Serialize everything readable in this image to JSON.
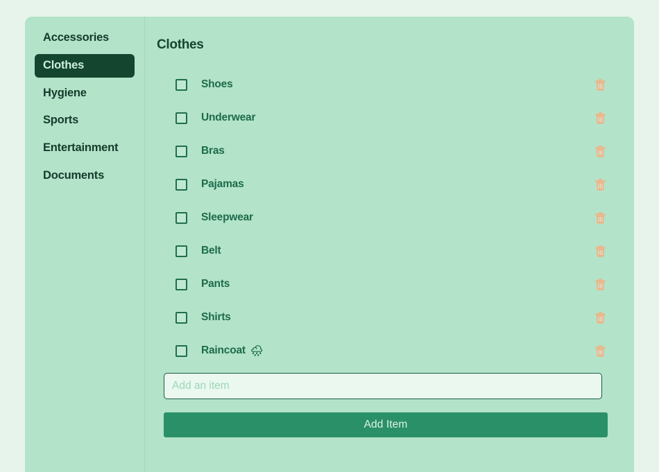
{
  "colors": {
    "page_background": "#e7f4ec",
    "panel_background": "#b3e3c9",
    "active_nav_background": "#14452f",
    "active_nav_text": "#cdeedd",
    "heading_text": "#14452f",
    "item_text": "#1d6b4b",
    "delete_icon": "#f2b183",
    "primary_button": "#2a9068",
    "primary_button_text": "#ddf3e8",
    "input_background": "#eaf8f0",
    "input_border": "#1d5b41",
    "input_placeholder": "#9cd6b7"
  },
  "sidebar": {
    "items": [
      {
        "label": "Accessories",
        "active": false
      },
      {
        "label": "Clothes",
        "active": true
      },
      {
        "label": "Hygiene",
        "active": false
      },
      {
        "label": "Sports",
        "active": false
      },
      {
        "label": "Entertainment",
        "active": false
      },
      {
        "label": "Documents",
        "active": false
      }
    ]
  },
  "main": {
    "title": "Clothes",
    "items": [
      {
        "label": "Shoes",
        "emoji": "",
        "checked": false,
        "delete_icon": "trash-icon"
      },
      {
        "label": "Underwear",
        "emoji": "",
        "checked": false,
        "delete_icon": "trash-icon"
      },
      {
        "label": "Bras",
        "emoji": "",
        "checked": false,
        "delete_icon": "trash-icon"
      },
      {
        "label": "Pajamas",
        "emoji": "",
        "checked": false,
        "delete_icon": "trash-icon"
      },
      {
        "label": "Sleepwear",
        "emoji": "",
        "checked": false,
        "delete_icon": "trash-icon"
      },
      {
        "label": "Belt",
        "emoji": "",
        "checked": false,
        "delete_icon": "trash-icon"
      },
      {
        "label": "Pants",
        "emoji": "",
        "checked": false,
        "delete_icon": "trash-icon"
      },
      {
        "label": "Shirts",
        "emoji": "",
        "checked": false,
        "delete_icon": "trash-icon"
      },
      {
        "label": "Raincoat",
        "emoji": "🌧",
        "checked": false,
        "delete_icon": "trash-icon"
      }
    ],
    "add_form": {
      "input_value": "",
      "input_placeholder": "Add an item",
      "button_label": "Add Item"
    }
  }
}
